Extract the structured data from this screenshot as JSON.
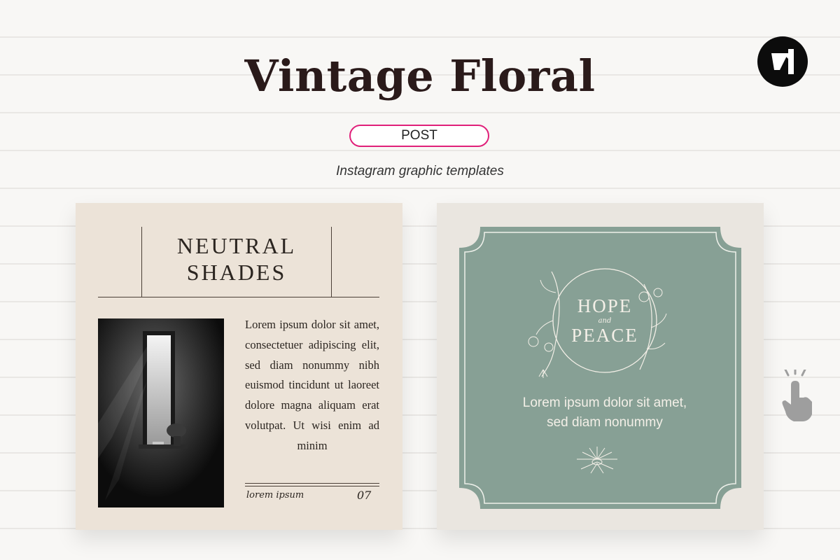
{
  "header": {
    "title": "Vintage Floral",
    "badge": "POST",
    "subtitle": "Instagram graphic templates"
  },
  "brand": {
    "logo_icon": "brand-logo-icon"
  },
  "card_left": {
    "heading_line1": "NEUTRAL",
    "heading_line2": "SHADES",
    "body": "Lorem ipsum dolor sit amet, consectetuer adipiscing elit, sed diam nonummy nibh euismod tincidunt ut laoreet dolore magna aliquam erat volutpat. Ut wisi enim ad minim",
    "footer_left": "lorem ipsum",
    "footer_right": "07"
  },
  "card_right": {
    "hope": "HOPE",
    "and": "and",
    "peace": "PEACE",
    "text_line1": "Lorem ipsum dolor sit amet,",
    "text_line2": "sed diam nonummy"
  },
  "colors": {
    "accent": "#e0207a",
    "sage": "#87a095",
    "beige": "#ece3d8",
    "title": "#2a1a1a"
  }
}
